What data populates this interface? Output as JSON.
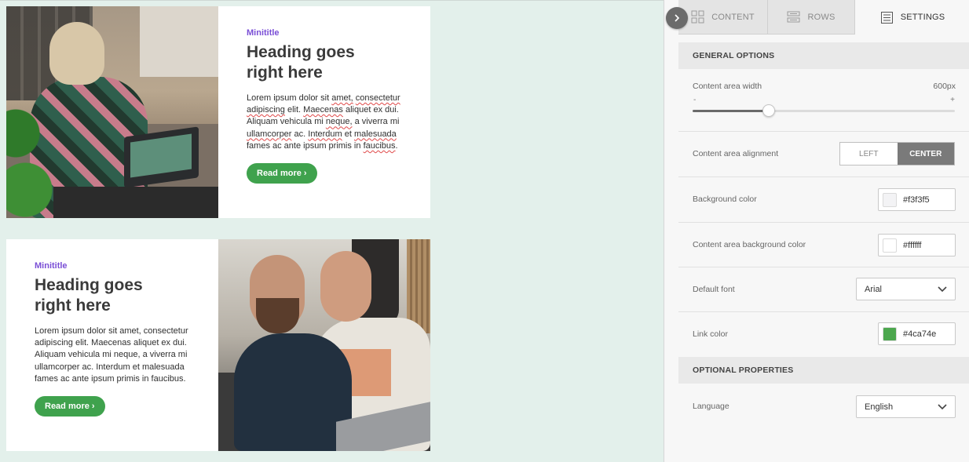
{
  "blocks": [
    {
      "minititle": "Minititle",
      "heading_line1": "Heading goes",
      "heading_line2": "right here",
      "body": [
        "Lorem ipsum dolor sit ",
        "amet,",
        " ",
        "consectetur",
        " ",
        "adipiscing",
        " elit. ",
        "Maecenas",
        " aliquet ex dui. Aliquam vehicula mi ",
        "neque,",
        " a viverra mi ",
        "ullamcorper",
        " ac. ",
        "Interdum",
        " et ",
        "malesuada",
        " fames ac ante ipsum primis in ",
        "faucibus",
        "."
      ],
      "button": "Read more ›"
    },
    {
      "minititle": "Minititle",
      "heading_line1": "Heading goes",
      "heading_line2": "right here",
      "body_text": "Lorem ipsum dolor sit amet, consectetur adipiscing elit. Maecenas aliquet ex dui. Aliquam vehicula mi neque, a viverra mi ullamcorper ac. Interdum et malesuada fames ac ante ipsum primis in faucibus.",
      "button": "Read more ›"
    }
  ],
  "panel": {
    "tabs": [
      {
        "label": "CONTENT",
        "icon": "grid-icon"
      },
      {
        "label": "ROWS",
        "icon": "rows-icon"
      },
      {
        "label": "SETTINGS",
        "icon": "settings-icon",
        "active": true
      }
    ],
    "general_options": "GENERAL OPTIONS",
    "content_width": {
      "label": "Content area width",
      "value": "600px",
      "min": "-",
      "max": "+",
      "level": 0.29
    },
    "alignment": {
      "label": "Content area alignment",
      "left": "LEFT",
      "center": "CENTER",
      "selected": "CENTER"
    },
    "background_color": {
      "label": "Background color",
      "value": "#f3f3f5"
    },
    "content_bg_color": {
      "label": "Content area background color",
      "value": "#ffffff"
    },
    "default_font": {
      "label": "Default font",
      "value": "Arial"
    },
    "link_color": {
      "label": "Link color",
      "value": "#4ca74e"
    },
    "optional_properties": "OPTIONAL PROPERTIES",
    "language": {
      "label": "Language",
      "value": "English"
    }
  },
  "colors": {
    "canvas_bg": "#e3f0eb",
    "accent_green": "#3fa24d",
    "minititle_purple": "#7a4fd6"
  }
}
